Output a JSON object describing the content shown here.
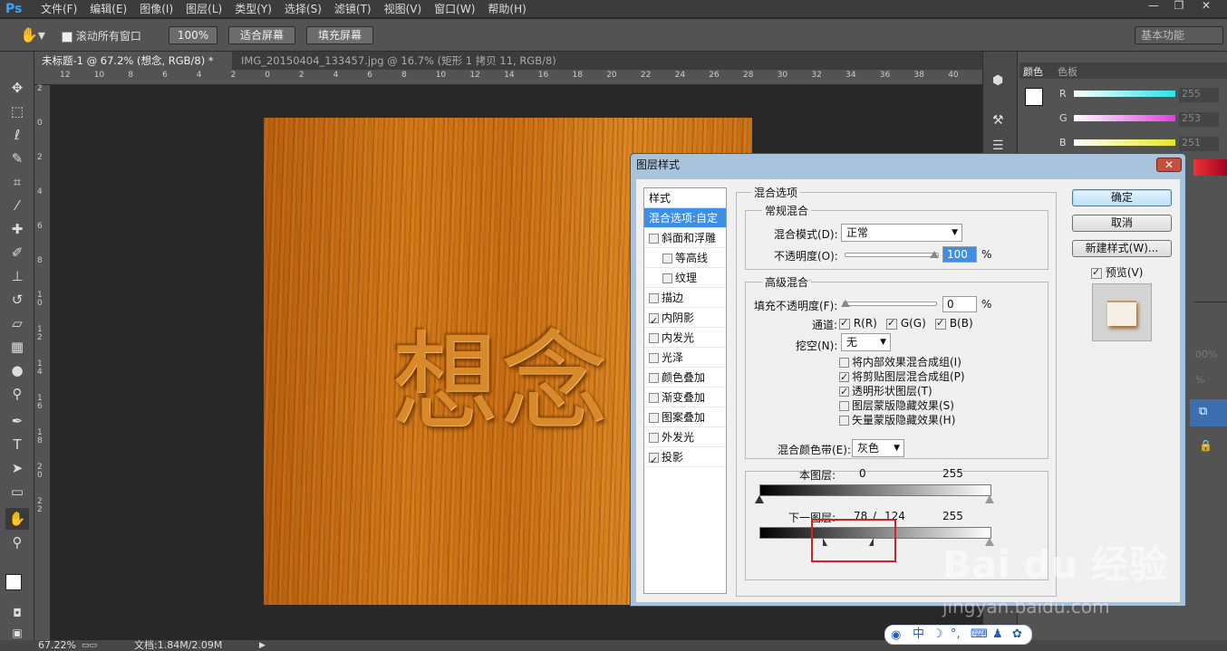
{
  "app": {
    "logo": "Ps"
  },
  "menubar": {
    "items": [
      "文件(F)",
      "编辑(E)",
      "图像(I)",
      "图层(L)",
      "类型(Y)",
      "选择(S)",
      "滤镜(T)",
      "视图(V)",
      "窗口(W)",
      "帮助(H)"
    ],
    "minimize": "—",
    "restore": "❐",
    "close": "✕"
  },
  "options": {
    "scroll_all_label": "滚动所有窗口",
    "zoom_btn": "100%",
    "fit_btn": "适合屏幕",
    "fill_btn": "填充屏幕",
    "workspace": "基本功能"
  },
  "tabs": [
    {
      "label": "未标题-1 @ 67.2% (想念, RGB/8) *",
      "close": "×"
    },
    {
      "label": "IMG_20150404_133457.jpg @ 16.7% (矩形 1 拷贝 11, RGB/8) *",
      "close": "×"
    }
  ],
  "ruler": {
    "h_ticks": [
      "12",
      "10",
      "8",
      "6",
      "4",
      "2",
      "0",
      "2",
      "4",
      "6",
      "8",
      "10",
      "12",
      "14",
      "16",
      "18",
      "20",
      "22",
      "24",
      "26",
      "28",
      "30",
      "32",
      "34",
      "36",
      "38",
      "40"
    ],
    "v_ticks": [
      "2",
      "0",
      "2",
      "4",
      "6",
      "8",
      "1 0",
      "1 2",
      "1 4",
      "1 6",
      "1 8",
      "2 0",
      "2 2"
    ]
  },
  "canvas": {
    "text": "想念"
  },
  "color_panel": {
    "tabs": [
      "颜色",
      "色板"
    ],
    "channels": [
      {
        "label": "R",
        "value": "255",
        "color": "#2ee3e3"
      },
      {
        "label": "G",
        "value": "253",
        "color": "#e040e0"
      },
      {
        "label": "B",
        "value": "251",
        "color": "#e6e62a"
      }
    ],
    "fg_color": "#fffdfb",
    "bg_color": "#d7a86e"
  },
  "right_panel": {
    "opacity_partial": "00%",
    "fill_partial": "%"
  },
  "dialog": {
    "title": "图层样式",
    "close": "✕",
    "styles_header": "样式",
    "styles": [
      {
        "label": "混合选项:自定",
        "checked": false,
        "has_checkbox": false,
        "selected": true,
        "sub": false
      },
      {
        "label": "斜面和浮雕",
        "checked": false,
        "has_checkbox": true,
        "selected": false,
        "sub": false
      },
      {
        "label": "等高线",
        "checked": false,
        "has_checkbox": true,
        "selected": false,
        "sub": true
      },
      {
        "label": "纹理",
        "checked": false,
        "has_checkbox": true,
        "selected": false,
        "sub": true
      },
      {
        "label": "描边",
        "checked": false,
        "has_checkbox": true,
        "selected": false,
        "sub": false
      },
      {
        "label": "内阴影",
        "checked": true,
        "has_checkbox": true,
        "selected": false,
        "sub": false
      },
      {
        "label": "内发光",
        "checked": false,
        "has_checkbox": true,
        "selected": false,
        "sub": false
      },
      {
        "label": "光泽",
        "checked": false,
        "has_checkbox": true,
        "selected": false,
        "sub": false
      },
      {
        "label": "颜色叠加",
        "checked": false,
        "has_checkbox": true,
        "selected": false,
        "sub": false
      },
      {
        "label": "渐变叠加",
        "checked": false,
        "has_checkbox": true,
        "selected": false,
        "sub": false
      },
      {
        "label": "图案叠加",
        "checked": false,
        "has_checkbox": true,
        "selected": false,
        "sub": false
      },
      {
        "label": "外发光",
        "checked": false,
        "has_checkbox": true,
        "selected": false,
        "sub": false
      },
      {
        "label": "投影",
        "checked": true,
        "has_checkbox": true,
        "selected": false,
        "sub": false
      }
    ],
    "blend_options_title": "混合选项",
    "general_title": "常规混合",
    "blend_mode_label": "混合模式(D):",
    "blend_mode_value": "正常",
    "opacity_label": "不透明度(O):",
    "opacity_value": "100",
    "percent": "%",
    "advanced_title": "高级混合",
    "fill_opacity_label": "填充不透明度(F):",
    "fill_opacity_value": "0",
    "channels_label": "通道:",
    "channel_r": "R(R)",
    "channel_g": "G(G)",
    "channel_b": "B(B)",
    "knockout_label": "挖空(N):",
    "knockout_value": "无",
    "adv_checks": [
      {
        "label": "将内部效果混合成组(I)",
        "checked": false
      },
      {
        "label": "将剪贴图层混合成组(P)",
        "checked": true
      },
      {
        "label": "透明形状图层(T)",
        "checked": true
      },
      {
        "label": "图层蒙版隐藏效果(S)",
        "checked": false
      },
      {
        "label": "矢量蒙版隐藏效果(H)",
        "checked": false
      }
    ],
    "blend_if_label": "混合颜色带(E):",
    "blend_if_value": "灰色",
    "this_layer_label": "本图层:",
    "this_layer_low": "0",
    "this_layer_high": "255",
    "under_layer_label": "下一图层:",
    "under_layer_low": "78",
    "under_layer_sep": "/",
    "under_layer_mid": "124",
    "under_layer_high": "255",
    "ok": "确定",
    "cancel": "取消",
    "new_style": "新建样式(W)...",
    "preview_label": "预览(V)",
    "preview_checked": true
  },
  "status": {
    "zoom": "67.22%",
    "doc": "文档:1.84M/2.09M"
  },
  "watermark": {
    "main": "Bai du 经验",
    "sub": "jingyan.baidu.com"
  },
  "ime": {
    "items": [
      "中",
      "☽",
      "°,",
      "⌨",
      "♟",
      "✿"
    ]
  }
}
